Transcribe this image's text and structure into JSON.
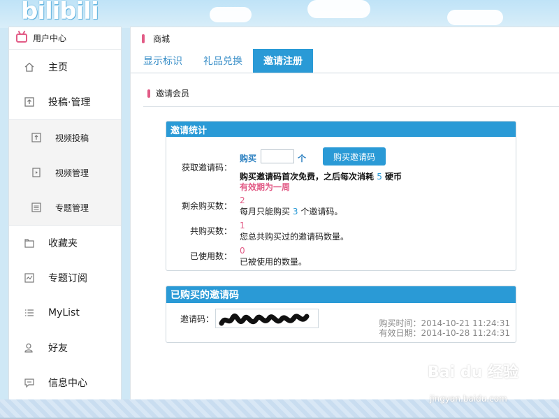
{
  "brand": {
    "logo_text": "bilibili",
    "accent": "#2a9ad6",
    "pink": "#e25b86"
  },
  "sidebar": {
    "header": "用户中心",
    "items": [
      {
        "label": "主页",
        "icon": "home-icon"
      },
      {
        "label": "投稿·管理",
        "icon": "upload-icon"
      }
    ],
    "sub_items": [
      {
        "label": "视频投稿",
        "icon": "upload-small-icon"
      },
      {
        "label": "视频管理",
        "icon": "video-file-icon"
      },
      {
        "label": "专题管理",
        "icon": "list-doc-icon"
      }
    ],
    "items_after": [
      {
        "label": "收藏夹",
        "icon": "folder-icon"
      },
      {
        "label": "专题订阅",
        "icon": "chart-icon"
      },
      {
        "label": "MyList",
        "icon": "list-icon"
      },
      {
        "label": "好友",
        "icon": "friends-icon"
      },
      {
        "label": "信息中心",
        "icon": "message-icon"
      }
    ]
  },
  "main": {
    "header": "商城",
    "tabs": [
      {
        "label": "显示标识",
        "active": false
      },
      {
        "label": "礼品兑换",
        "active": false
      },
      {
        "label": "邀请注册",
        "active": true
      }
    ],
    "section_title": "邀请会员"
  },
  "stats_box": {
    "title": "邀请统计",
    "get_code_label": "获取邀请码：",
    "buy_label": "购买",
    "quantity_value": "",
    "unit_label": "个",
    "buy_button": "购买邀请码",
    "note_prefix": "购买邀请码首次免费，之后每次消耗",
    "note_cost": "5",
    "note_suffix": "硬币",
    "validity_note": "有效期为一周",
    "remaining_label": "剩余购买数：",
    "remaining_value": "2",
    "monthly_prefix": "每月只能购买",
    "monthly_count": "3",
    "monthly_suffix": "个邀请码。",
    "total_label": "共购买数：",
    "total_value": "1",
    "total_desc": "您总共购买过的邀请码数量。",
    "used_label": "已使用数：",
    "used_value": "0",
    "used_desc": "已被使用的数量。"
  },
  "codes_box": {
    "title": "已购买的邀请码",
    "code_label": "邀请码：",
    "purchase_time": "购买时间：2014-10-21 11:24:31",
    "valid_date": "有效日期：2014-10-28 11:24:31"
  },
  "watermark": {
    "text": "Bai du 经验",
    "sub": "jingyan.baidu.com"
  }
}
